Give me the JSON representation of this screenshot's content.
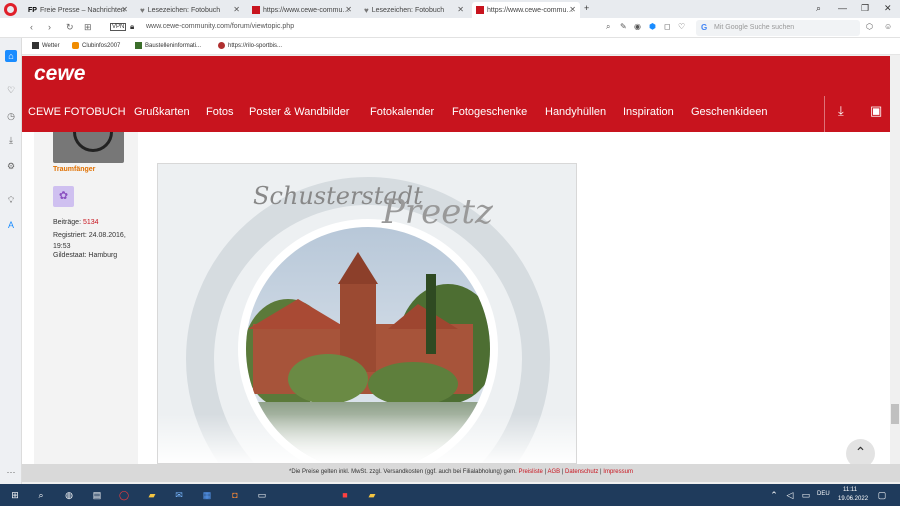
{
  "browser": {
    "tabs": [
      {
        "label": "Freie Presse – Nachrichten",
        "favicon": "fp"
      },
      {
        "label": "Lesezeichen: Fotobuch",
        "favicon": "heart"
      },
      {
        "label": "https://www.cewe-commu…",
        "favicon": "cewe"
      },
      {
        "label": "Lesezeichen: Fotobuch",
        "favicon": "heart"
      },
      {
        "label": "https://www.cewe-commu…",
        "favicon": "cewe",
        "active": true
      }
    ],
    "new_tab": "+",
    "vpn_label": "VPN",
    "url": "www.cewe-community.com/forum/viewtopic.php",
    "search_placeholder": "Mit Google Suche suchen",
    "search_engine_glyph": "G"
  },
  "bookmarks": [
    {
      "label": "Wetter"
    },
    {
      "label": "Clubinfos2007"
    },
    {
      "label": "Baustelleninformati..."
    },
    {
      "label": "https://rilo-sportbis..."
    }
  ],
  "site": {
    "logo": "cewe",
    "nav": [
      "CEWE FOTOBUCH",
      "Grußkarten",
      "Fotos",
      "Poster & Wandbilder",
      "Fotokalender",
      "Fotogeschenke",
      "Handyhüllen",
      "Inspiration",
      "Geschenkideen"
    ],
    "brand_color": "#c8141e"
  },
  "post": {
    "username": "Traumfänger",
    "posts_label": "Beiträge:",
    "posts_count": "5134",
    "registered": "Registriert: 24.08.2016, 19:53",
    "state": "Gildestaat: Hamburg",
    "image_title_1": "Schusterstadt",
    "image_title_2": "Preetz"
  },
  "footer": {
    "text": "*Die Preise gelten inkl. MwSt. zzgl. Versandkosten (ggf. auch bei Filialabholung) gem.",
    "links": [
      "Preisliste",
      "AGB",
      "Datenschutz",
      "Impressum"
    ],
    "sep": "|"
  },
  "taskbar": {
    "lang": "DEU",
    "time": "11:11",
    "date": "19.06.2022"
  }
}
